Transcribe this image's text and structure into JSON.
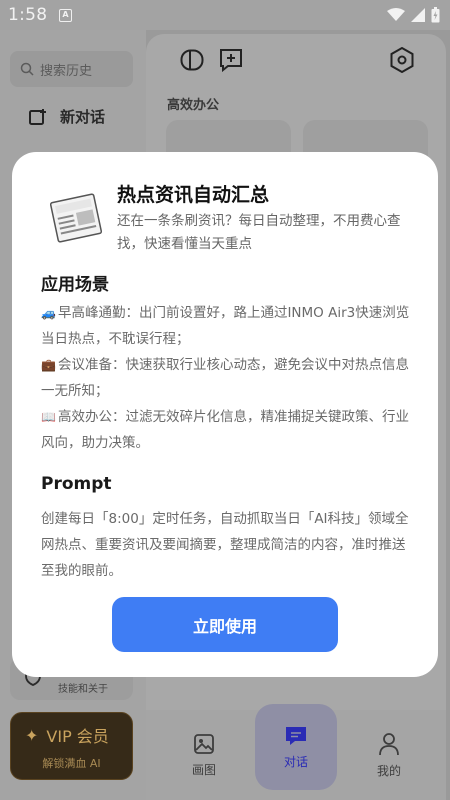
{
  "status_bar": {
    "time": "1:58",
    "notification_badge": "A"
  },
  "drawer": {
    "search_placeholder": "搜索历史",
    "new_chat_label": "新对话",
    "skills_sub_label": "技能和关于",
    "vip": {
      "title": "VIP 会员",
      "subtitle": "解锁满血 AI"
    }
  },
  "main": {
    "section_title": "高效办公",
    "bottom_nav": [
      {
        "label": "画图",
        "icon": "image-icon",
        "active": false
      },
      {
        "label": "对话",
        "icon": "chat-icon",
        "active": true
      },
      {
        "label": "我的",
        "icon": "person-icon",
        "active": false
      }
    ]
  },
  "modal": {
    "icon": "newspaper-icon",
    "title": "热点资讯自动汇总",
    "description": "还在一条条刷资讯？每日自动整理，不用费心查找，快速看懂当天重点",
    "scenarios_heading": "应用场景",
    "scenarios": [
      {
        "emoji": "🚙",
        "text": "早高峰通勤：出门前设置好，路上通过INMO Air3快速浏览当日热点，不耽误行程；"
      },
      {
        "emoji": "💼",
        "text": "会议准备：快速获取行业核心动态，避免会议中对热点信息一无所知；"
      },
      {
        "emoji": "📖",
        "text": "高效办公：过滤无效碎片化信息，精准捕捉关键政策、行业风向，助力决策。"
      }
    ],
    "prompt_heading": "Prompt",
    "prompt_text": "创建每日「8:00」定时任务，自动抓取当日「AI科技」领域全网热点、重要资讯及要闻摘要，整理成简洁的内容，准时推送至我的眼前。",
    "cta_label": "立即使用"
  },
  "colors": {
    "accent": "#3f7df4",
    "vip_gold": "#c9a35e",
    "active_nav": "#2a2bb5"
  }
}
